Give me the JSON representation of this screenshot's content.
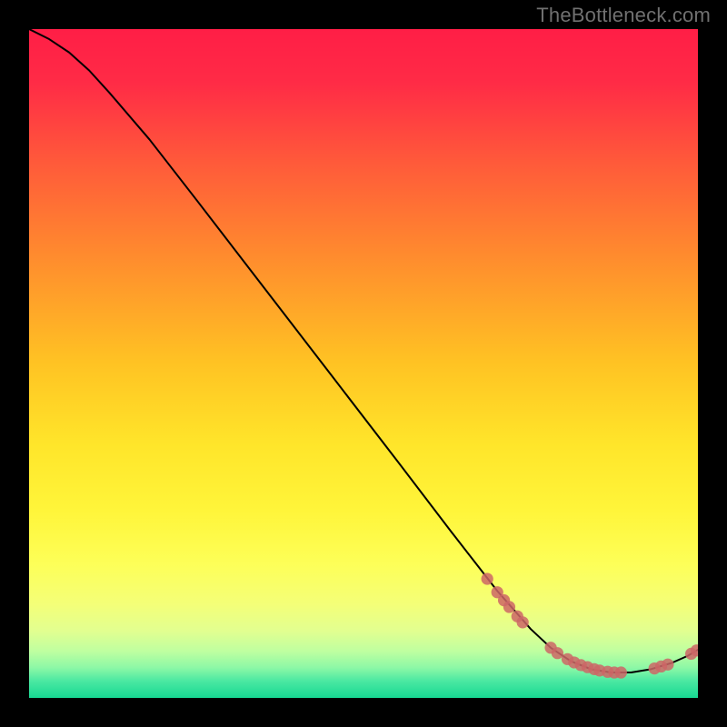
{
  "watermark": "TheBottleneck.com",
  "plot": {
    "width_units": 100,
    "height_units": 100
  },
  "gradient_stops": [
    {
      "pct": 0,
      "color": "#ff1e46"
    },
    {
      "pct": 8,
      "color": "#ff2b46"
    },
    {
      "pct": 20,
      "color": "#ff5a3a"
    },
    {
      "pct": 35,
      "color": "#ff8f2d"
    },
    {
      "pct": 50,
      "color": "#ffc323"
    },
    {
      "pct": 62,
      "color": "#ffe52a"
    },
    {
      "pct": 72,
      "color": "#fff53a"
    },
    {
      "pct": 80,
      "color": "#fdff58"
    },
    {
      "pct": 86,
      "color": "#f4ff78"
    },
    {
      "pct": 90,
      "color": "#e2ff90"
    },
    {
      "pct": 93,
      "color": "#bfffa0"
    },
    {
      "pct": 95.5,
      "color": "#8cf8a6"
    },
    {
      "pct": 97.5,
      "color": "#4ae8a2"
    },
    {
      "pct": 100,
      "color": "#17d892"
    }
  ],
  "curve_points": [
    {
      "x": 0,
      "y": 100
    },
    {
      "x": 3,
      "y": 98.5
    },
    {
      "x": 6,
      "y": 96.5
    },
    {
      "x": 9,
      "y": 93.8
    },
    {
      "x": 12,
      "y": 90.5
    },
    {
      "x": 18,
      "y": 83.5
    },
    {
      "x": 25,
      "y": 74.5
    },
    {
      "x": 35,
      "y": 61.5
    },
    {
      "x": 45,
      "y": 48.5
    },
    {
      "x": 55,
      "y": 35.5
    },
    {
      "x": 63,
      "y": 25.0
    },
    {
      "x": 70,
      "y": 16.0
    },
    {
      "x": 75,
      "y": 10.3
    },
    {
      "x": 78,
      "y": 7.5
    },
    {
      "x": 81,
      "y": 5.5
    },
    {
      "x": 84,
      "y": 4.3
    },
    {
      "x": 87,
      "y": 3.8
    },
    {
      "x": 90,
      "y": 3.8
    },
    {
      "x": 93,
      "y": 4.3
    },
    {
      "x": 96,
      "y": 5.2
    },
    {
      "x": 98.5,
      "y": 6.3
    },
    {
      "x": 100,
      "y": 7.2
    }
  ],
  "markers": [
    {
      "x": 68.5,
      "y": 17.8
    },
    {
      "x": 70.0,
      "y": 15.8
    },
    {
      "x": 71.0,
      "y": 14.6
    },
    {
      "x": 71.8,
      "y": 13.6
    },
    {
      "x": 73.0,
      "y": 12.2
    },
    {
      "x": 73.8,
      "y": 11.3
    },
    {
      "x": 78.0,
      "y": 7.5
    },
    {
      "x": 79.0,
      "y": 6.7
    },
    {
      "x": 80.5,
      "y": 5.8
    },
    {
      "x": 81.5,
      "y": 5.3
    },
    {
      "x": 82.5,
      "y": 4.9
    },
    {
      "x": 83.5,
      "y": 4.6
    },
    {
      "x": 84.5,
      "y": 4.3
    },
    {
      "x": 85.3,
      "y": 4.1
    },
    {
      "x": 86.5,
      "y": 3.9
    },
    {
      "x": 87.5,
      "y": 3.8
    },
    {
      "x": 88.5,
      "y": 3.8
    },
    {
      "x": 93.5,
      "y": 4.4
    },
    {
      "x": 94.5,
      "y": 4.7
    },
    {
      "x": 95.5,
      "y": 5.0
    },
    {
      "x": 99.0,
      "y": 6.6
    },
    {
      "x": 99.8,
      "y": 7.1
    }
  ],
  "chart_data": {
    "type": "line",
    "title": "",
    "xlabel": "",
    "ylabel": "",
    "xlim": [
      0,
      100
    ],
    "ylim": [
      0,
      100
    ],
    "x": [
      0,
      3,
      6,
      9,
      12,
      18,
      25,
      35,
      45,
      55,
      63,
      70,
      75,
      78,
      81,
      84,
      87,
      90,
      93,
      96,
      98.5,
      100
    ],
    "y": [
      100,
      98.5,
      96.5,
      93.8,
      90.5,
      83.5,
      74.5,
      61.5,
      48.5,
      35.5,
      25.0,
      16.0,
      10.3,
      7.5,
      5.5,
      4.3,
      3.8,
      3.8,
      4.3,
      5.2,
      6.3,
      7.2
    ],
    "markers_x": [
      68.5,
      70.0,
      71.0,
      71.8,
      73.0,
      73.8,
      78.0,
      79.0,
      80.5,
      81.5,
      82.5,
      83.5,
      84.5,
      85.3,
      86.5,
      87.5,
      88.5,
      93.5,
      94.5,
      95.5,
      99.0,
      99.8
    ],
    "markers_y": [
      17.8,
      15.8,
      14.6,
      13.6,
      12.2,
      11.3,
      7.5,
      6.7,
      5.8,
      5.3,
      4.9,
      4.6,
      4.3,
      4.1,
      3.9,
      3.8,
      3.8,
      4.4,
      4.7,
      5.0,
      6.6,
      7.1
    ],
    "curve_color": "#000000",
    "marker_color": "#cc6666",
    "background_gradient": "vertical red→yellow→green"
  }
}
